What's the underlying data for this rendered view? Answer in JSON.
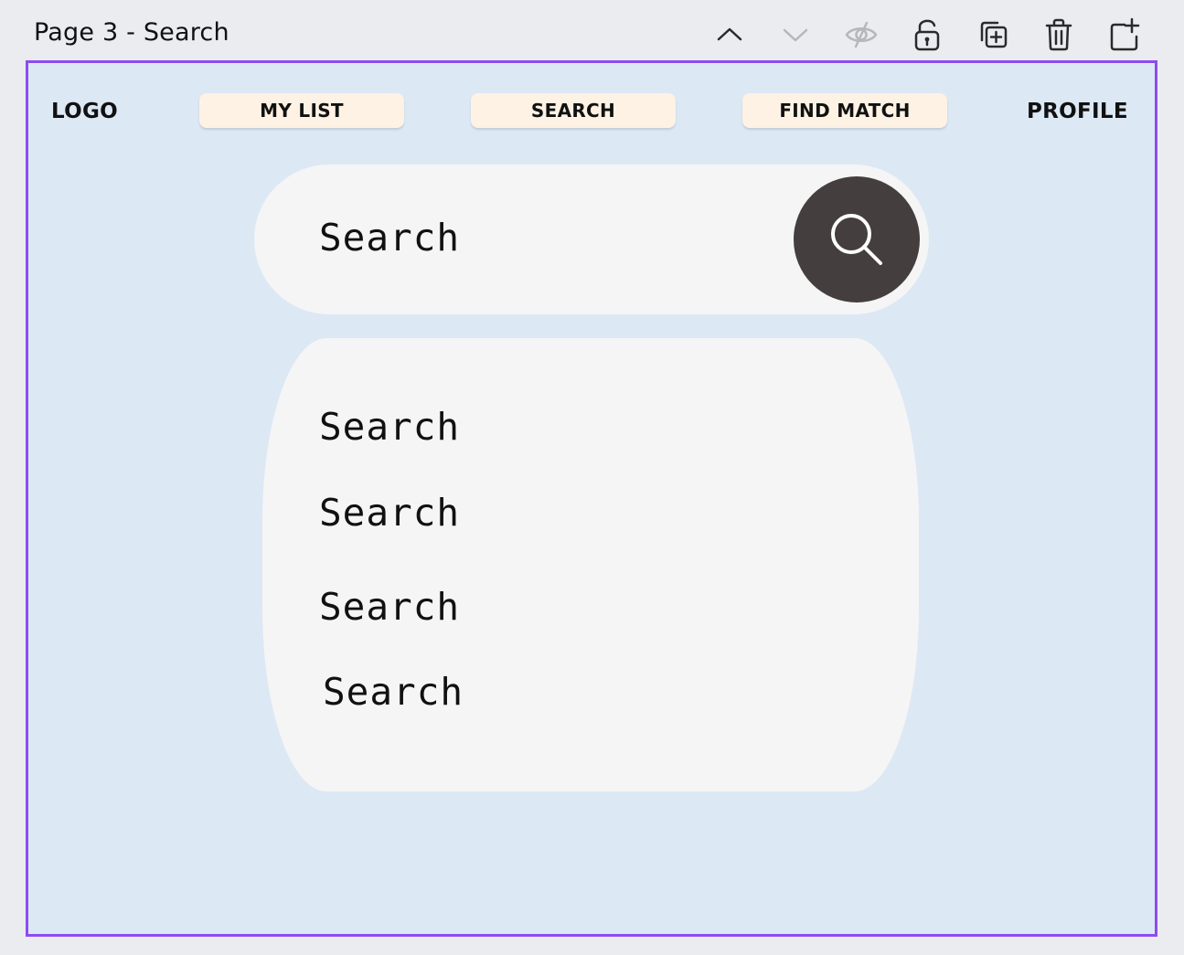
{
  "page": {
    "title": "Page 3 - Search"
  },
  "toolbar": {
    "icons": [
      "chevron-up-icon",
      "chevron-down-icon",
      "eye-hidden-icon",
      "unlock-icon",
      "duplicate-icon",
      "trash-icon",
      "add-page-icon"
    ]
  },
  "nav": {
    "logo": "LOGO",
    "my_list": "MY LIST",
    "search": "SEARCH",
    "find_match": "FIND MATCH",
    "profile": "PROFILE"
  },
  "search": {
    "placeholder": "Search"
  },
  "results": [
    {
      "label": "Search"
    },
    {
      "label": "Search"
    },
    {
      "label": "Search"
    },
    {
      "label": "Search"
    }
  ],
  "colors": {
    "frame_border": "#8b4df0",
    "frame_background": "#dde8f5",
    "nav_pill": "#fdf2e4",
    "search_button": "#453e3e",
    "panel": "#f5f5f5"
  }
}
